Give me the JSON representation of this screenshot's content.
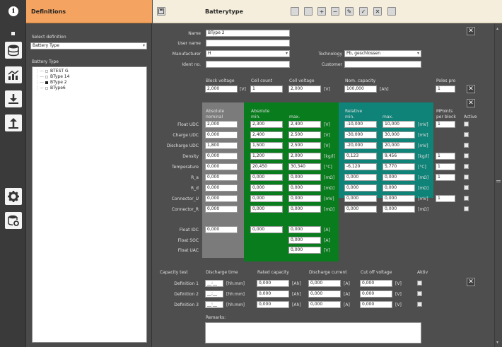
{
  "header": {
    "info_icon": "info-icon",
    "left_title": "Definitions",
    "right_title": "Batterytype",
    "toolbar_icons": [
      "new-icon",
      "copy-icon",
      "add-icon",
      "remove-icon",
      "edit-icon",
      "check-icon",
      "close-icon",
      "export-icon"
    ]
  },
  "sidebar": {
    "icons": [
      "database-icon",
      "chart-icon",
      "download-icon",
      "upload-icon",
      "gear-icon",
      "database-settings-icon"
    ]
  },
  "left": {
    "select_label": "Select definition",
    "select_value": "Battery Type",
    "tree_label": "Battery Type",
    "tree_items": [
      "BTEST G",
      "BType 14",
      "BType 2",
      "BType6"
    ]
  },
  "form": {
    "name_label": "Name",
    "name_value": "BType 2",
    "username_label": "User name",
    "username_value": "",
    "manufacturer_label": "Manufacturer",
    "manufacturer_value": "H",
    "idno_label": "Ident no.",
    "idno_value": "",
    "technology_label": "Technology",
    "technology_value": "Pb, geschlossen",
    "customer_label": "Customer",
    "customer_value": "",
    "block_voltage_label": "Block voltage",
    "block_voltage_value": "2,000",
    "block_voltage_unit": "[V]",
    "cell_count_label": "Cell count",
    "cell_count_value": "1",
    "cell_voltage_label": "Cell voltage",
    "cell_voltage_value": "2,000",
    "cell_voltage_unit": "[V]",
    "nom_capacity_label": "Nom. capacity",
    "nom_capacity_value": "100,000",
    "nom_capacity_unit": "[Ah]",
    "poles_label": "Poles pro",
    "poles_value": "1"
  },
  "table": {
    "hdr_abs_1": "Absolute",
    "hdr_abs_2": "nominal",
    "hdr_absmm_1": "Absolute",
    "hdr_absmm_min": "min.",
    "hdr_absmm_max": "max.",
    "hdr_rel_1": "Relative",
    "hdr_rel_min": "min.",
    "hdr_rel_max": "max.",
    "hdr_mp_1": "MPoints",
    "hdr_mp_2": "per block",
    "hdr_active": "Active",
    "rows": [
      {
        "label": "Float UDC",
        "nom": "2,000",
        "amin": "2,300",
        "amax": "2,400",
        "aunit": "[V]",
        "rmin": "-10,000",
        "rmax": "10,000",
        "runit": "[mV]",
        "mp": "1"
      },
      {
        "label": "Charge UDC",
        "nom": "0,000",
        "amin": "2,400",
        "amax": "2,500",
        "aunit": "[V]",
        "rmin": "-30,000",
        "rmax": "30,000",
        "runit": "[mV]",
        "mp": ""
      },
      {
        "label": "Discharge UDC",
        "nom": "1,800",
        "amin": "1,500",
        "amax": "2,500",
        "aunit": "[V]",
        "rmin": "-20,000",
        "rmax": "20,000",
        "runit": "[mV]",
        "mp": ""
      },
      {
        "label": "Density",
        "nom": "0,000",
        "amin": "1,200",
        "amax": "2,000",
        "aunit": "[kg/l]",
        "rmin": "0,123",
        "rmax": "9,456",
        "runit": "[kg/l]",
        "mp": "1"
      },
      {
        "label": "Temperature",
        "nom": "0,000",
        "amin": "20,450",
        "amax": "30,340",
        "aunit": "[°C]",
        "rmin": "-6,120",
        "rmax": "5,770",
        "runit": "[°C]",
        "mp": "1"
      },
      {
        "label": "R_a",
        "nom": "0,000",
        "amin": "0,000",
        "amax": "0,000",
        "aunit": "[mΩ]",
        "rmin": "0,000",
        "rmax": "0,000",
        "runit": "[mΩ]",
        "mp": "1"
      },
      {
        "label": "R_d",
        "nom": "0,000",
        "amin": "0,000",
        "amax": "0,000",
        "aunit": "[mΩ]",
        "rmin": "0,000",
        "rmax": "0,000",
        "runit": "[mΩ]",
        "mp": ""
      },
      {
        "label": "Connector_U",
        "nom": "0,000",
        "amin": "0,000",
        "amax": "0,000",
        "aunit": "[mV]",
        "rmin": "0,000",
        "rmax": "0,000",
        "runit": "[mV]",
        "mp": "1"
      },
      {
        "label": "Connector_R",
        "nom": "0,000",
        "amin": "0,000",
        "amax": "0,000",
        "aunit": "[mΩ]",
        "rmin": "0,000",
        "rmax": "0,000",
        "runit": "[mΩ]",
        "mp": ""
      }
    ],
    "float_idc_label": "Float IDC",
    "float_idc_nom": "0,000",
    "float_idc_min": "0,000",
    "float_idc_max": "0,000",
    "float_idc_unit": "[A]",
    "float_soc_label": "Float SOC",
    "float_soc_max": "0,000",
    "float_soc_unit": "[A]",
    "float_uac_label": "Float UAC",
    "float_uac_max": "0,000",
    "float_uac_unit": "[V]"
  },
  "capacity": {
    "title": "Capacity test",
    "hdr_time": "Discharge time",
    "hdr_rated": "Rated capacity",
    "hdr_current": "Discharge current",
    "hdr_cutoff": "Cut off voltage",
    "hdr_active": "Aktiv",
    "rows": [
      {
        "label": "Definition 1",
        "time": "__:__",
        "tunit": "[hh:mm]",
        "rated": "0,000",
        "runit": "[Ah]",
        "current": "0,000",
        "cunit": "[A]",
        "cutoff": "0,000",
        "vunit": "[V]"
      },
      {
        "label": "Definition 2",
        "time": "__:__",
        "tunit": "[hh:mm]",
        "rated": "0,000",
        "runit": "[Ah]",
        "current": "0,000",
        "cunit": "[A]",
        "cutoff": "0,000",
        "vunit": "[V]"
      },
      {
        "label": "Definition 3",
        "time": "__:__",
        "tunit": "[hh:mm]",
        "rated": "0,000",
        "runit": "[Ah]",
        "current": "0,000",
        "cunit": "[A]",
        "cutoff": "0,000",
        "vunit": "[V]"
      }
    ],
    "remarks_label": "Remarks:",
    "remarks_value": ""
  }
}
